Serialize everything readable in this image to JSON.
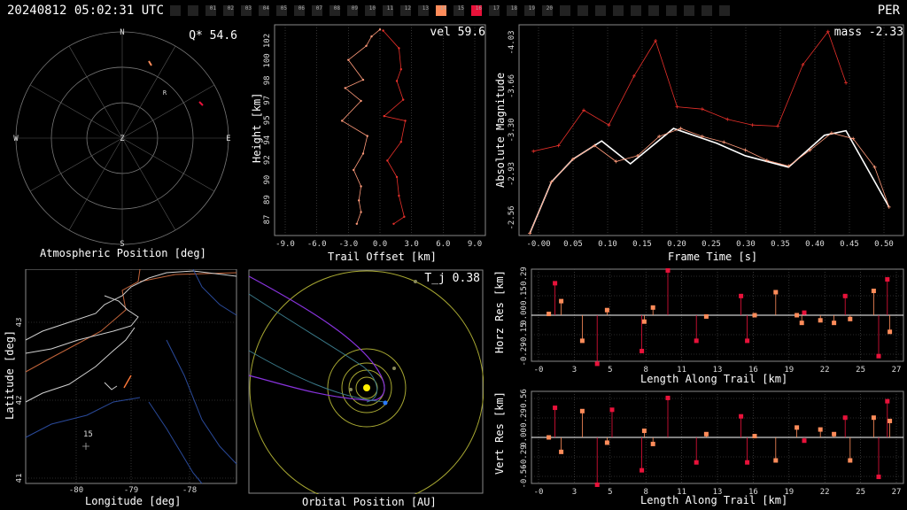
{
  "header": {
    "timestamp": "20240812 05:02:31 UTC",
    "shower": "PER",
    "stations": [
      "",
      "",
      "01",
      "02",
      "03",
      "04",
      "05",
      "06",
      "07",
      "08",
      "09",
      "10",
      "11",
      "12",
      "13",
      "14",
      "15",
      "16",
      "17",
      "18",
      "19",
      "20",
      "",
      "",
      "",
      "",
      "",
      "",
      "",
      "",
      "",
      ""
    ],
    "active": {
      "14": "#ff8c5a",
      "16": "#e8123a"
    }
  },
  "sky": {
    "title": "Atmospheric Position [deg]",
    "stat": "Q* 54.6",
    "dirs": {
      "n": "N",
      "s": "S",
      "e": "E",
      "w": "W",
      "z": "Z",
      "r": "R"
    }
  },
  "trail": {
    "title": "Trail Offset [km]",
    "ylabel": "Height [km]",
    "stat": "vel 59.6"
  },
  "lc": {
    "title": "Frame Time [s]",
    "ylabel": "Absolute Magnitude",
    "stat": "mass -2.33"
  },
  "map": {
    "xlabel": "Longitude [deg]",
    "ylabel": "Latitude [deg]",
    "station_label": "15"
  },
  "orbit": {
    "title": "Orbital Position [AU]",
    "stat": "T_j 0.38"
  },
  "hres": {
    "xlabel": "Length Along Trail [km]",
    "ylabel": "Horz Res [km]"
  },
  "vres": {
    "xlabel": "Length Along Trail [km]",
    "ylabel": "Vert Res [km]"
  },
  "chart_data": [
    {
      "type": "line",
      "name": "trail",
      "xlabel": "Trail Offset [km]",
      "ylabel": "Height [km]",
      "x_ticks": [
        "-9.0",
        "-6.0",
        "-3.0",
        "0.0",
        "3.0",
        "6.0",
        "9.0"
      ],
      "xlim": [
        -10,
        10
      ],
      "y_ticks": [
        "87",
        "89",
        "90",
        "92",
        "94",
        "95",
        "97",
        "98",
        "100",
        "102"
      ],
      "ylim": [
        86,
        104
      ],
      "series": [
        {
          "color": "#ff9a7a",
          "x": [
            0.0,
            -0.8,
            -1.3,
            -3.0,
            -1.6,
            -3.3,
            -1.8,
            -3.6,
            -1.2,
            -1.6,
            -2.5,
            -1.8,
            -2.0,
            -1.8,
            -2.2
          ],
          "y": [
            103.6,
            103.0,
            102.2,
            101.0,
            99.3,
            98.6,
            97.5,
            95.8,
            94.5,
            93.0,
            91.6,
            90.2,
            89.0,
            88.0,
            87.0
          ]
        },
        {
          "color": "#e8302a",
          "x": [
            0.3,
            1.8,
            2.0,
            1.6,
            2.2,
            0.4,
            2.4,
            2.0,
            0.7,
            1.6,
            1.8,
            2.3,
            1.3
          ],
          "y": [
            103.5,
            102.0,
            100.2,
            99.2,
            97.6,
            96.2,
            95.8,
            94.0,
            92.4,
            91.0,
            89.4,
            87.6,
            87.0
          ]
        }
      ]
    },
    {
      "type": "line",
      "name": "lightcurve",
      "xlabel": "Frame Time [s]",
      "ylabel": "Absolute Magnitude",
      "x_ticks": [
        "-0.00",
        "0.05",
        "0.10",
        "0.15",
        "0.20",
        "0.25",
        "0.30",
        "0.35",
        "0.40",
        "0.45",
        "0.50"
      ],
      "xlim": [
        -0.015,
        0.52
      ],
      "y_ticks": [
        "-4.03",
        "-3.66",
        "-3.30",
        "-2.93",
        "-2.56"
      ],
      "ylim": [
        -4.2,
        -2.35
      ],
      "series": [
        {
          "name": "fit",
          "color": "#ffffff",
          "x": [
            0.0,
            0.03,
            0.06,
            0.1,
            0.14,
            0.2,
            0.26,
            0.3,
            0.36,
            0.41,
            0.44,
            0.5
          ],
          "y": [
            -2.37,
            -2.82,
            -3.02,
            -3.18,
            -2.98,
            -3.29,
            -3.16,
            -3.05,
            -2.95,
            -3.23,
            -3.27,
            -2.6
          ]
        },
        {
          "color": "#e8302a",
          "x": [
            0.005,
            0.04,
            0.075,
            0.11,
            0.145,
            0.175,
            0.205,
            0.24,
            0.275,
            0.31,
            0.345,
            0.38,
            0.415,
            0.44
          ],
          "y": [
            -3.09,
            -3.14,
            -3.45,
            -3.32,
            -3.75,
            -4.06,
            -3.48,
            -3.46,
            -3.37,
            -3.32,
            -3.31,
            -3.85,
            -4.14,
            -3.69
          ]
        },
        {
          "color": "#ff9a7a",
          "x": [
            0.0,
            0.03,
            0.06,
            0.09,
            0.12,
            0.15,
            0.18,
            0.21,
            0.24,
            0.27,
            0.3,
            0.33,
            0.36,
            0.39,
            0.42,
            0.45,
            0.48,
            0.5
          ],
          "y": [
            -2.37,
            -2.82,
            -3.02,
            -3.14,
            -3.0,
            -3.05,
            -3.22,
            -3.29,
            -3.22,
            -3.17,
            -3.1,
            -3.01,
            -2.96,
            -3.1,
            -3.25,
            -3.2,
            -2.95,
            -2.6
          ]
        }
      ]
    },
    {
      "type": "scatter",
      "name": "horizontal_residuals",
      "xlabel": "Length Along Trail [km]",
      "ylabel": "Horz Res [km]",
      "x_ticks": [
        "-0",
        "3",
        "5",
        "8",
        "11",
        "13",
        "16",
        "19",
        "22",
        "25",
        "27"
      ],
      "xlim": [
        -1.5,
        28.5
      ],
      "y_ticks": [
        "0.29",
        "0.15",
        "0.00",
        "-0.15",
        "-0.29"
      ],
      "ylim": [
        -0.36,
        0.36
      ],
      "series": [
        {
          "color": "#e8123a",
          "x": [
            0.4,
            3.8,
            7.4,
            9.5,
            11.8,
            15.4,
            15.9,
            20.5,
            23.8,
            26.5,
            27.2
          ],
          "y": [
            0.25,
            -0.38,
            -0.28,
            0.35,
            -0.2,
            0.15,
            -0.2,
            0.02,
            0.15,
            -0.32,
            0.28
          ]
        },
        {
          "color": "#ff8c5a",
          "x": [
            -0.1,
            0.9,
            2.6,
            4.6,
            7.6,
            8.3,
            12.6,
            16.5,
            18.2,
            19.9,
            20.3,
            21.8,
            22.9,
            24.2,
            26.1,
            27.4
          ],
          "y": [
            0.01,
            0.11,
            -0.2,
            0.04,
            -0.05,
            0.06,
            -0.01,
            0.0,
            0.18,
            0.0,
            -0.06,
            -0.04,
            -0.06,
            -0.03,
            0.19,
            -0.13
          ]
        }
      ]
    },
    {
      "type": "scatter",
      "name": "vertical_residuals",
      "xlabel": "Length Along Trail [km]",
      "ylabel": "Vert Res [km]",
      "x_ticks": [
        "-0",
        "3",
        "5",
        "8",
        "11",
        "13",
        "16",
        "19",
        "22",
        "25",
        "27"
      ],
      "xlim": [
        -1.5,
        28.5
      ],
      "y_ticks": [
        "0.56",
        "0.29",
        "0.00",
        "-0.29",
        "-0.56"
      ],
      "ylim": [
        -0.7,
        0.7
      ],
      "series": [
        {
          "color": "#e8123a",
          "x": [
            0.4,
            3.8,
            5.0,
            7.4,
            9.5,
            11.8,
            15.4,
            15.9,
            20.5,
            23.8,
            26.5,
            27.2
          ],
          "y": [
            0.45,
            -0.72,
            0.42,
            -0.5,
            0.6,
            -0.38,
            0.32,
            -0.38,
            -0.05,
            0.3,
            -0.6,
            0.55
          ]
        },
        {
          "color": "#ff8c5a",
          "x": [
            -0.1,
            0.9,
            2.6,
            4.6,
            7.6,
            8.3,
            12.6,
            16.5,
            18.2,
            19.9,
            21.8,
            22.9,
            24.2,
            26.1,
            27.4
          ],
          "y": [
            0.0,
            -0.22,
            0.4,
            -0.08,
            0.1,
            -0.1,
            0.05,
            0.02,
            -0.35,
            0.15,
            0.12,
            0.05,
            -0.35,
            0.3,
            0.25
          ]
        }
      ]
    }
  ]
}
